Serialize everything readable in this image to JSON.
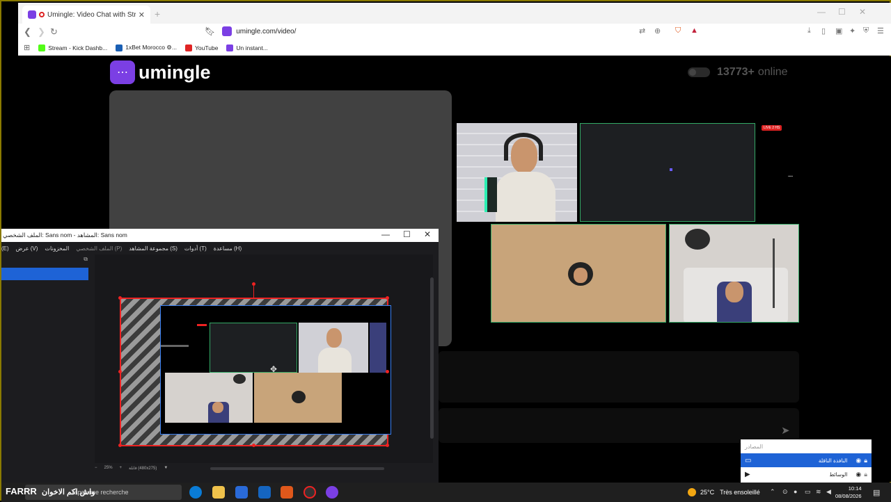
{
  "browser": {
    "tab_title": "Umingle: Video Chat with Str",
    "url": "umingle.com/video/",
    "bookmarks": [
      {
        "label": "Stream - Kick Dashb...",
        "color": "#53fc18"
      },
      {
        "label": "1xBet Morocco ⚙...",
        "color": "#1a5fb4"
      },
      {
        "label": "YouTube",
        "color": "#e02424"
      },
      {
        "label": "Un instant...",
        "color": "#7b3fe4"
      }
    ]
  },
  "page": {
    "brand": "umingle",
    "online_count": "13773+",
    "online_label": "online",
    "live_badge": "LIVE 2 HS"
  },
  "obs": {
    "title": "الملف الشخصي: Sans nom - المشاهد: Sans nom",
    "menu": [
      "(E)",
      "عرض (V)",
      "المخزونات",
      "الملف الشخصي (P)",
      "مجموعة المشاهد (S)",
      "أدوات (T)",
      "مساعدة (H)"
    ],
    "zoom": "25%",
    "canvas_info": "قابلة (480x275)"
  },
  "sources": {
    "header": "المصادر",
    "items": [
      {
        "label": "النافذة الناقلة",
        "selected": true
      },
      {
        "label": "الوسائط",
        "selected": false
      }
    ]
  },
  "taskbar": {
    "brand": "FARRR",
    "overlay": "واش اكم الاخوان",
    "search": "Taper une recherche",
    "temperature": "25°C",
    "weather": "Très ensoleillé",
    "time": "10:14",
    "date": "08/08/2026"
  }
}
